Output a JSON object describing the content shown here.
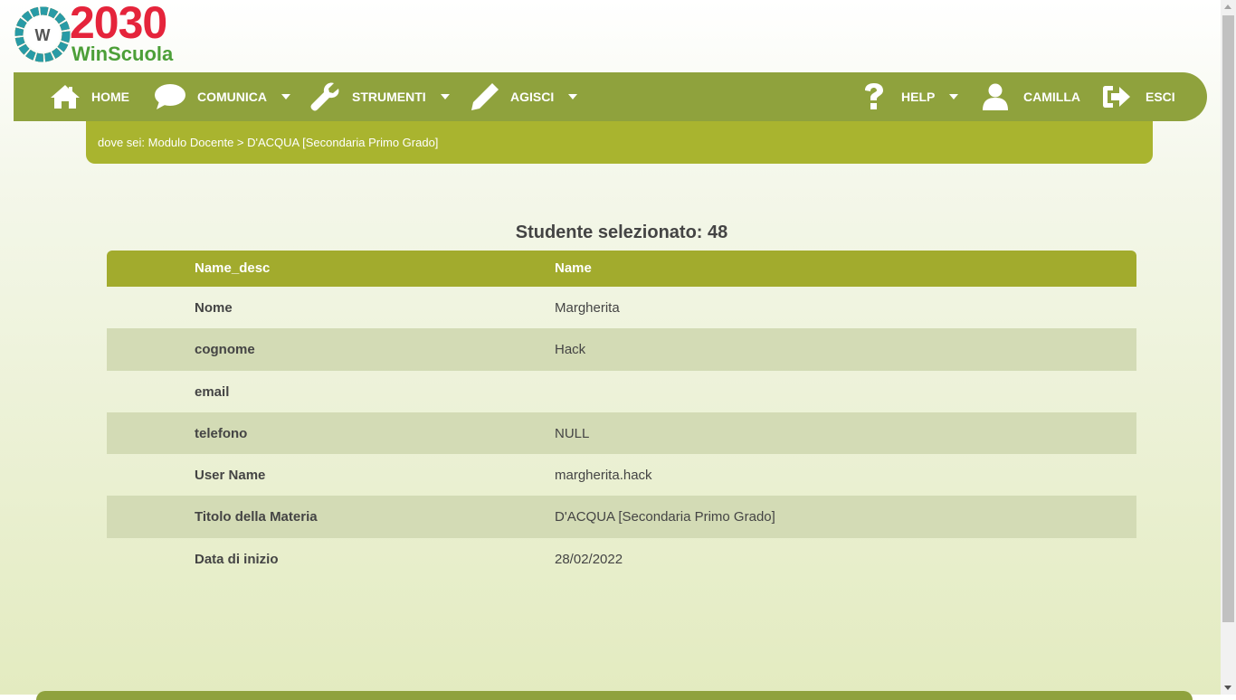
{
  "logo": {
    "year": "2030",
    "brand": "WinScuola",
    "letter": "W"
  },
  "nav": {
    "home": "HOME",
    "comunica": "COMUNICA",
    "strumenti": "STRUMENTI",
    "agisci": "AGISCI",
    "help": "HELP",
    "user": "CAMILLA",
    "esci": "ESCI"
  },
  "breadcrumb": "dove sei: Modulo Docente > D'ACQUA [Secondaria Primo Grado]",
  "title": "Studente selezionato: 48",
  "table": {
    "headers": [
      "Name_desc",
      "Name"
    ],
    "rows": [
      {
        "key": "Nome",
        "value": "Margherita"
      },
      {
        "key": "cognome",
        "value": "Hack"
      },
      {
        "key": "email",
        "value": ""
      },
      {
        "key": "telefono",
        "value": "NULL"
      },
      {
        "key": "User Name",
        "value": "margherita.hack"
      },
      {
        "key": "Titolo della Materia",
        "value": "D'ACQUA [Secondaria Primo Grado]"
      },
      {
        "key": "Data di inizio",
        "value": "28/02/2022"
      }
    ]
  },
  "colors": {
    "nav": "#8fa23d",
    "breadcrumb": "#a9b42f",
    "table_header": "#a2ab2d",
    "row_alt": "#d3dbb5"
  },
  "icons": [
    "home-icon",
    "chat-icon",
    "wrench-icon",
    "pencil-icon",
    "question-icon",
    "user-icon",
    "logout-icon"
  ]
}
